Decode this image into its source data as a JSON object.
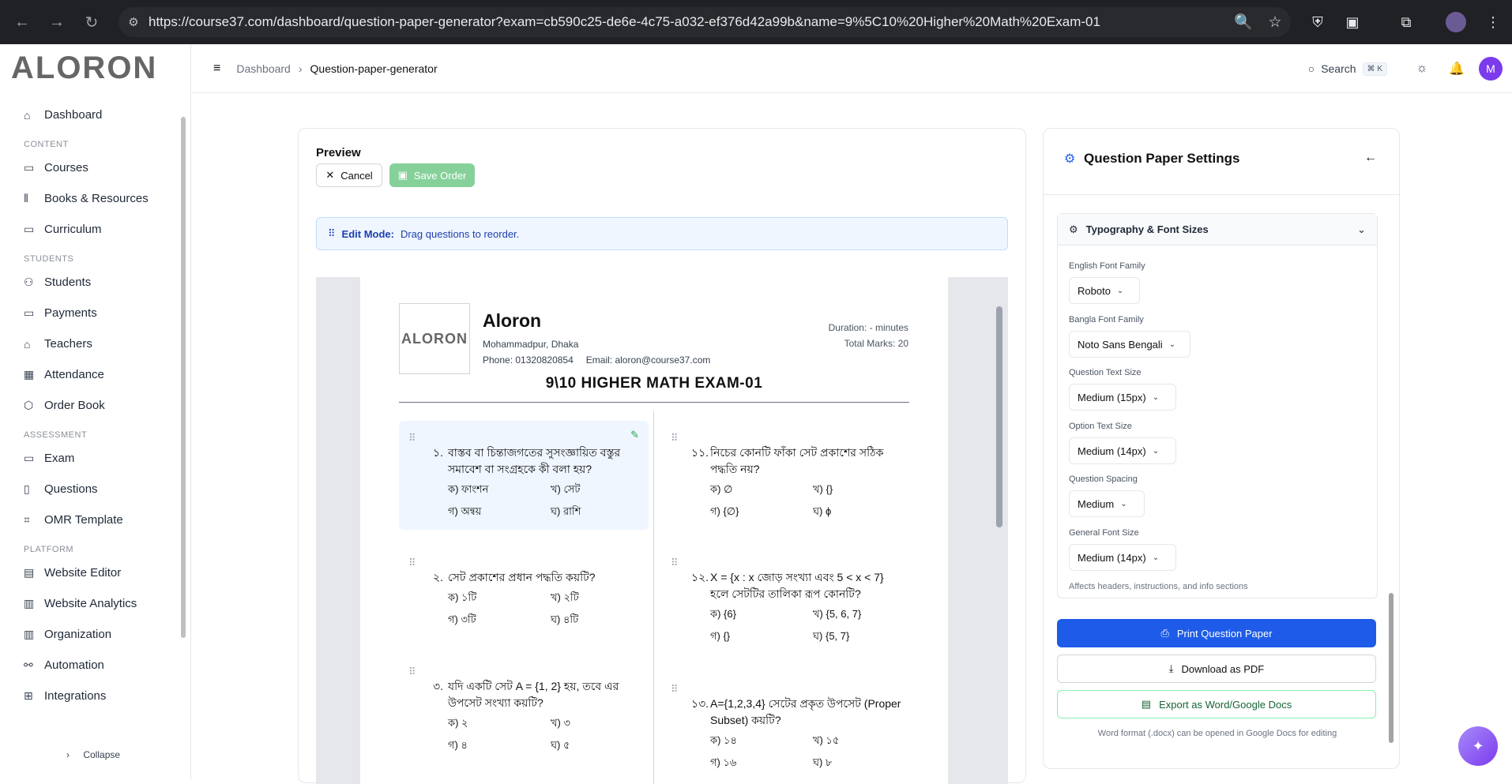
{
  "browser": {
    "url": "https://course37.com/dashboard/question-paper-generator?exam=cb590c25-de6e-4c75-a032-ef376d42a99b&name=9%5C10%20Higher%20Math%20Exam-01",
    "back_icon": "←",
    "forward_icon": "→",
    "reload_icon": "↻",
    "tune_icon": "⚙",
    "zoom_icon": "🔍",
    "star_icon": "☆",
    "shield_icon": "⛨",
    "puzzle_icon": "▣",
    "screen_icon": "⧉",
    "menu_icon": "⋮",
    "profile_icon": "●"
  },
  "sidebar": {
    "logo": "ALORON",
    "sections": [
      {
        "label": "",
        "items": [
          {
            "icon": "⌂",
            "label": "Dashboard"
          }
        ]
      },
      {
        "label": "CONTENT",
        "items": [
          {
            "icon": "▭",
            "label": "Courses"
          },
          {
            "icon": "⫴",
            "label": "Books & Resources"
          },
          {
            "icon": "▭",
            "label": "Curriculum"
          }
        ]
      },
      {
        "label": "STUDENTS",
        "items": [
          {
            "icon": "⚇",
            "label": "Students"
          },
          {
            "icon": "▭",
            "label": "Payments"
          },
          {
            "icon": "⌂",
            "label": "Teachers"
          },
          {
            "icon": "▦",
            "label": "Attendance"
          },
          {
            "icon": "⬡",
            "label": "Order Book"
          }
        ]
      },
      {
        "label": "ASSESSMENT",
        "items": [
          {
            "icon": "▭",
            "label": "Exam"
          },
          {
            "icon": "▯",
            "label": "Questions"
          },
          {
            "icon": "⌗",
            "label": "OMR Template"
          }
        ]
      },
      {
        "label": "PLATFORM",
        "items": [
          {
            "icon": "▤",
            "label": "Website Editor"
          },
          {
            "icon": "▥",
            "label": "Website Analytics"
          },
          {
            "icon": "▥",
            "label": "Organization"
          },
          {
            "icon": "⚯",
            "label": "Automation"
          },
          {
            "icon": "⊞",
            "label": "Integrations"
          }
        ]
      }
    ],
    "collapse_label": "Collapse",
    "collapse_icon": "›"
  },
  "topbar": {
    "menu_icon": "≡",
    "breadcrumb": [
      "Dashboard",
      "Question-paper-generator"
    ],
    "breadcrumb_sep": "›",
    "search_label": "Search",
    "search_kbd": "⌘ K",
    "search_icon": "○",
    "theme_icon": "☼",
    "bell_icon": "🔔",
    "avatar_letter": "M"
  },
  "preview": {
    "title": "Preview",
    "cancel_label": "Cancel",
    "cancel_icon": "✕",
    "save_label": "Save Order",
    "save_icon": "▣",
    "edit_mode_label": "Edit Mode:",
    "edit_mode_text": "Drag questions to reorder.",
    "edit_icon": "⠿",
    "paper": {
      "logo_text": "ALORON",
      "institution": "Aloron",
      "address": "Mohammadpur, Dhaka",
      "phone": "Phone: 01320820854",
      "email": "Email: aloron@course37.com",
      "duration": "Duration: - minutes",
      "total_marks": "Total Marks: 20",
      "exam_title": "9\\10 HIGHER MATH EXAM-01",
      "questions_left": [
        {
          "num": "১.",
          "text": "বাস্তব বা চিন্তাজগতের সুসংজ্ঞায়িত বস্তুর সমাবেশ বা সংগ্রহকে কী বলা হয়?",
          "options": [
            "ক) ফাংশন",
            "খ) সেট",
            "গ) অন্বয়",
            "ঘ) রাশি"
          ]
        },
        {
          "num": "২.",
          "text": "সেট প্রকাশের প্রধান পদ্ধতি কয়টি?",
          "options": [
            "ক) ১টি",
            "খ) ২টি",
            "গ) ৩টি",
            "ঘ) ৪টি"
          ]
        },
        {
          "num": "৩.",
          "text": "যদি একটি সেট A = {1, 2} হয়, তবে এর উপসেট সংখ্যা কয়টি?",
          "options": [
            "ক) ২",
            "খ) ৩",
            "গ) ৪",
            "ঘ) ৫"
          ]
        }
      ],
      "questions_right": [
        {
          "num": "১১.",
          "text": "নিচের কোনটি ফাঁকা সেট প্রকাশের সঠিক পদ্ধতি নয়?",
          "options": [
            "ক) ∅",
            "খ) {}",
            "গ) {∅}",
            "ঘ) ϕ"
          ]
        },
        {
          "num": "১২.",
          "text": "X = {x : x জোড় সংখ্যা এবং 5 < x < 7} হলে সেটটির তালিকা রূপ কোনটি?",
          "options": [
            "ক) {6}",
            "খ) {5, 6, 7}",
            "গ) {}",
            "ঘ) {5, 7}"
          ]
        },
        {
          "num": "১৩.",
          "text": "A={1,2,3,4} সেটের প্রকৃত উপসেট (Proper Subset) কয়টি?",
          "options": [
            "ক) ১৪",
            "খ) ১৫",
            "গ) ১৬",
            "ঘ) ৮"
          ]
        }
      ]
    }
  },
  "settings": {
    "title": "Question Paper Settings",
    "gear_icon": "⚙",
    "back_icon": "←",
    "section_title": "Typography & Font Sizes",
    "section_chevron": "⌄",
    "fields": [
      {
        "label": "English Font Family",
        "value": "Roboto"
      },
      {
        "label": "Bangla Font Family",
        "value": "Noto Sans Bengali"
      },
      {
        "label": "Question Text Size",
        "value": "Medium (15px)"
      },
      {
        "label": "Option Text Size",
        "value": "Medium (14px)"
      },
      {
        "label": "Question Spacing",
        "value": "Medium"
      },
      {
        "label": "General Font Size",
        "value": "Medium (14px)"
      }
    ],
    "general_hint": "Affects headers, instructions, and info sections",
    "print_label": "Print Question Paper",
    "print_icon": "⎙",
    "pdf_label": "Download as PDF",
    "pdf_icon": "⤓",
    "word_label": "Export as Word/Google Docs",
    "word_icon": "▤",
    "word_hint": "Word format (.docx) can be opened in Google Docs for editing"
  },
  "fab_icon": "✦",
  "colors": {
    "accent": "#1d5be8",
    "save_green": "#86d19a",
    "avatar": "#7c3aed"
  }
}
